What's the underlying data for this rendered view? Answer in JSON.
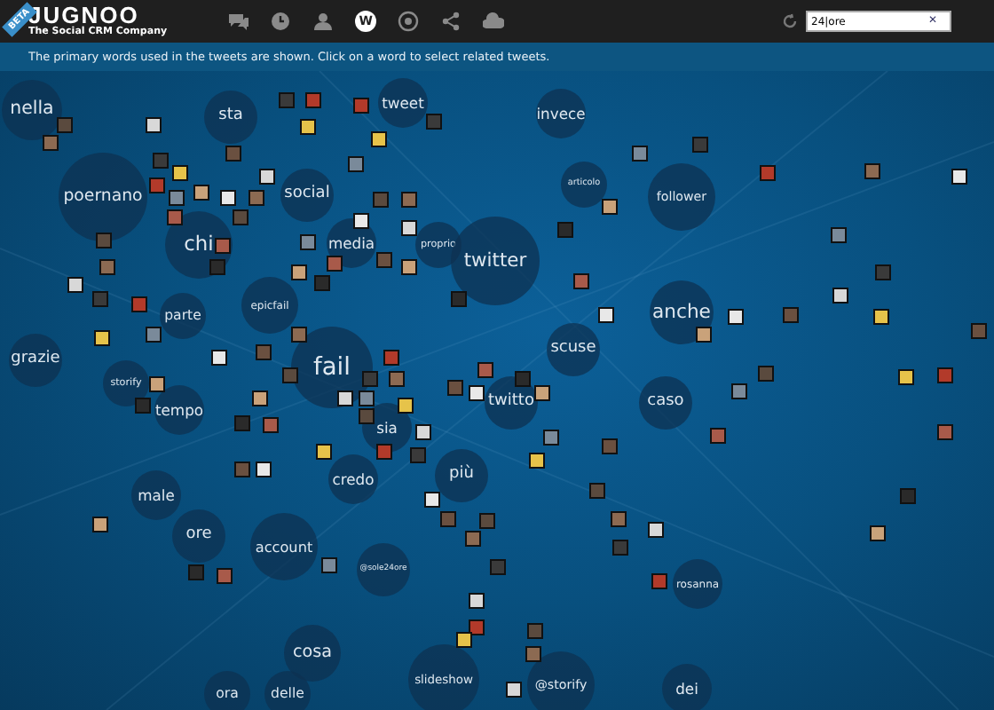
{
  "brand": {
    "name": "JUGNOO",
    "tagline": "The Social CRM Company",
    "ribbon": "BETA"
  },
  "nav_icons": [
    {
      "kind": "chat",
      "selected": false
    },
    {
      "kind": "clock",
      "selected": false
    },
    {
      "kind": "person",
      "selected": false
    },
    {
      "kind": "words",
      "label": "W",
      "selected": true
    },
    {
      "kind": "target",
      "selected": false
    },
    {
      "kind": "share",
      "selected": false
    },
    {
      "kind": "cloud",
      "selected": false
    }
  ],
  "search": {
    "value": "24|ore",
    "clear": "✕"
  },
  "info_text": "The primary words used in the tweets are shown. Click on a word to select related tweets.",
  "words": [
    "nella",
    "poernano",
    "sta",
    "chi",
    "social",
    "media",
    "proprio",
    "twitter",
    "tweet",
    "invece",
    "articolo",
    "follower",
    "anche",
    "scuse",
    "caso",
    "twitto",
    "epicfail",
    "parte",
    "grazie",
    "fail",
    "storify",
    "tempo",
    "sia",
    "più",
    "credo",
    "account",
    "ore",
    "male",
    "@sole24ore",
    "cosa",
    "slideshow",
    "ora",
    "delle",
    "rosanna",
    "@storify",
    "dei"
  ]
}
